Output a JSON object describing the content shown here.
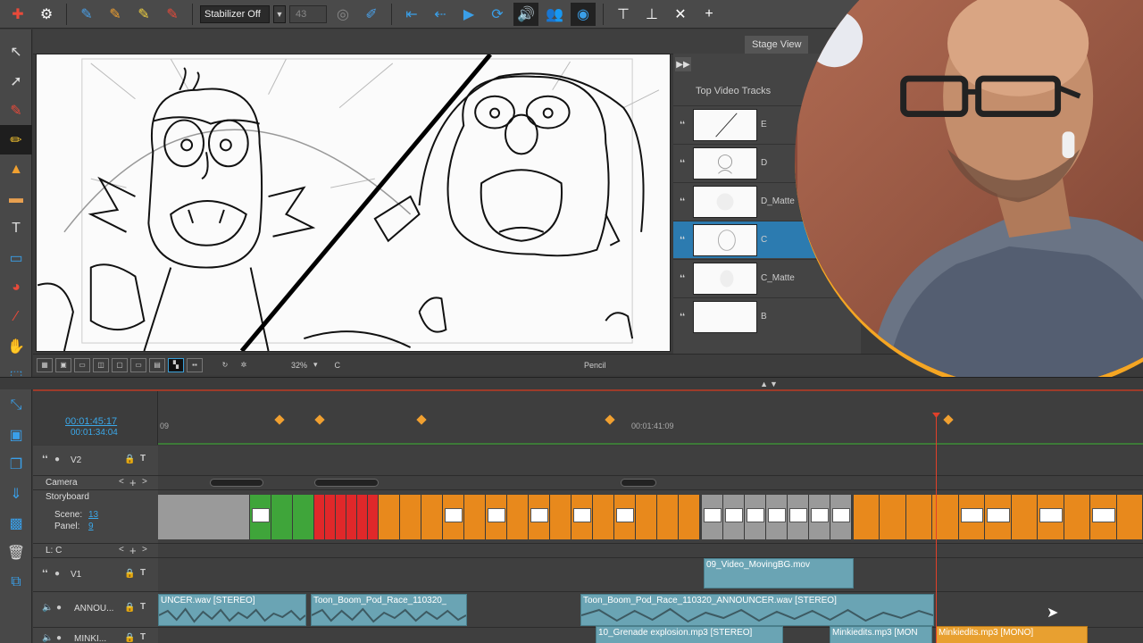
{
  "toolbar": {
    "stabilizer": "Stabilizer Off",
    "stabilizer_value": "43"
  },
  "stage": {
    "tab_label": "Stage View",
    "zoom": "32%",
    "layer": "C",
    "tool_name": "Pencil"
  },
  "top_tracks": {
    "title": "Top Video Tracks",
    "items": [
      {
        "name": "E"
      },
      {
        "name": "D"
      },
      {
        "name": "D_Matte"
      },
      {
        "name": "C"
      },
      {
        "name": "C_Matte"
      },
      {
        "name": "B"
      }
    ]
  },
  "timeline": {
    "timecode_main": "00:01:45:17",
    "timecode_sub": "00:01:34:04",
    "ruler_left": "09",
    "ruler_mid": "00:01:41:09",
    "tracks": {
      "v2": "V2",
      "camera": "Camera",
      "storyboard": "Storyboard",
      "scene_label": "Scene:",
      "scene_value": "13",
      "panel_label": "Panel:",
      "panel_value": "9",
      "lc": "L: C",
      "v1": "V1",
      "announ": "ANNOU...",
      "minki": "MINKI..."
    },
    "clips": {
      "video1": "09_Video_MovingBG.mov",
      "audio1": "UNCER.wav [STEREO]",
      "audio2": "Toon_Boom_Pod_Race_110320_",
      "audio3": "Toon_Boom_Pod_Race_110320_ANNOUNCER.wav [STEREO]",
      "audio4": "10_Grenade explosion.mp3 [STEREO]",
      "audio5": "Minkiedits.mp3 [MON",
      "audio6": "Minkiedits.mp3 [MONO]"
    }
  },
  "colors": {
    "orange_panel": "#e8891c",
    "red_panel": "#e0282a",
    "green_panel": "#3fa53a",
    "gray_panel": "#9a9a9a",
    "audio_clip": "#6aa4b4",
    "accent_blue": "#3ba7e8"
  }
}
